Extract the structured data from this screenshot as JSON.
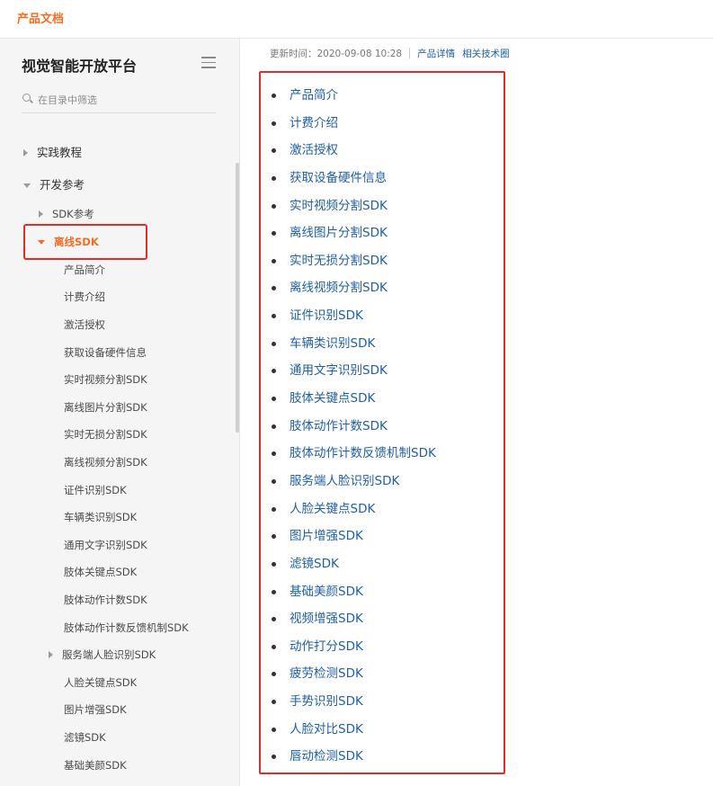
{
  "topbar": {
    "brand": "产品文档"
  },
  "sidebar": {
    "title": "视觉智能开放平台",
    "filter_placeholder": "在目录中筛选",
    "tree": [
      {
        "label": "实践教程",
        "state": "collapsed"
      },
      {
        "label": "开发参考",
        "state": "expanded"
      },
      {
        "label": "SDK参考",
        "state": "collapsed"
      },
      {
        "label": "离线SDK",
        "state": "expanded-active"
      }
    ],
    "items": [
      {
        "label": "产品简介"
      },
      {
        "label": "计费介绍"
      },
      {
        "label": "激活授权"
      },
      {
        "label": "获取设备硬件信息"
      },
      {
        "label": "实时视频分割SDK"
      },
      {
        "label": "离线图片分割SDK"
      },
      {
        "label": "实时无损分割SDK"
      },
      {
        "label": "离线视频分割SDK"
      },
      {
        "label": "证件识别SDK"
      },
      {
        "label": "车辆类识别SDK"
      },
      {
        "label": "通用文字识别SDK"
      },
      {
        "label": "肢体关键点SDK"
      },
      {
        "label": "肢体动作计数SDK"
      },
      {
        "label": "肢体动作计数反馈机制SDK"
      },
      {
        "label": "服务端人脸识别SDK",
        "has_children": true
      },
      {
        "label": "人脸关键点SDK"
      },
      {
        "label": "图片增强SDK"
      },
      {
        "label": "滤镜SDK"
      },
      {
        "label": "基础美颜SDK"
      }
    ]
  },
  "main": {
    "updated_label": "更新时间：2020-09-08 10:28",
    "links": [
      "产品详情",
      "相关技术圈"
    ],
    "doc_links": [
      "产品简介",
      "计费介绍",
      "激活授权",
      "获取设备硬件信息",
      "实时视频分割SDK",
      "离线图片分割SDK",
      "实时无损分割SDK",
      "离线视频分割SDK",
      "证件识别SDK",
      "车辆类识别SDK",
      "通用文字识别SDK",
      "肢体关键点SDK",
      "肢体动作计数SDK",
      "肢体动作计数反馈机制SDK",
      "服务端人脸识别SDK",
      "人脸关键点SDK",
      "图片增强SDK",
      "滤镜SDK",
      "基础美颜SDK",
      "视频增强SDK",
      "动作打分SDK",
      "疲劳检测SDK",
      "手势识别SDK",
      "人脸对比SDK",
      "唇动检测SDK"
    ]
  },
  "colors": {
    "accent": "#f56d23",
    "link": "#1f5fa8",
    "highlight_box": "#e02c2c"
  }
}
